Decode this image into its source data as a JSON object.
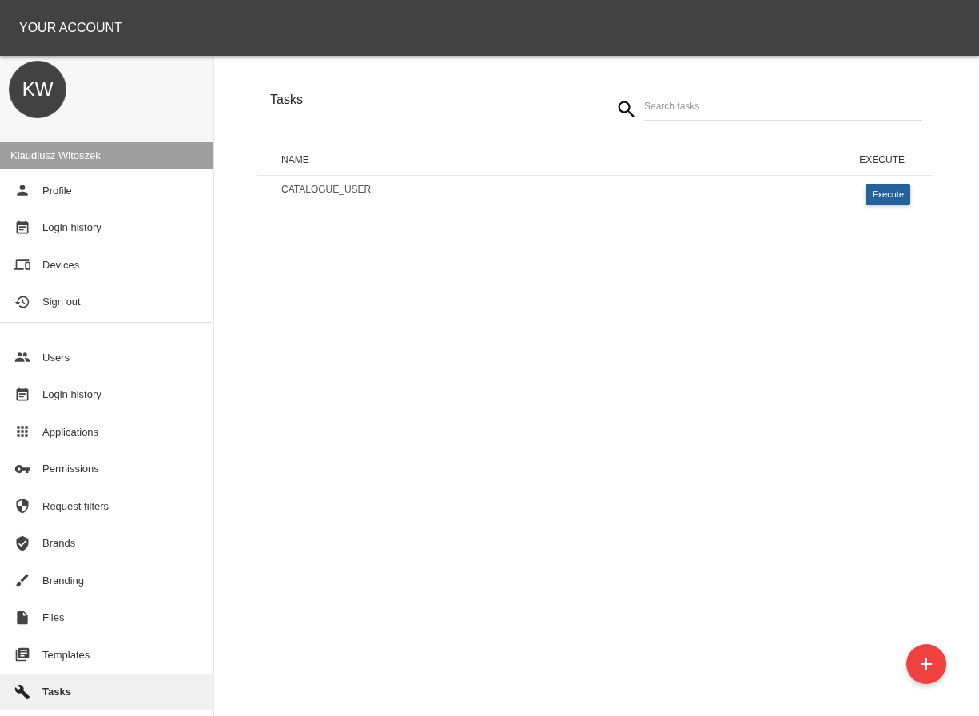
{
  "header": {
    "title": "YOUR ACCOUNT"
  },
  "user": {
    "initials": "KW",
    "name": "Klaudiusz Witoszek"
  },
  "sidebar": {
    "account_items": [
      {
        "label": "Profile",
        "selected": false
      },
      {
        "label": "Login history",
        "selected": false
      },
      {
        "label": "Devices",
        "selected": false
      },
      {
        "label": "Sign out",
        "selected": false
      }
    ],
    "admin_items": [
      {
        "label": "Users",
        "selected": false
      },
      {
        "label": "Login history",
        "selected": false
      },
      {
        "label": "Applications",
        "selected": false
      },
      {
        "label": "Permissions",
        "selected": false
      },
      {
        "label": "Request filters",
        "selected": false
      },
      {
        "label": "Brands",
        "selected": false
      },
      {
        "label": "Branding",
        "selected": false
      },
      {
        "label": "Files",
        "selected": false
      },
      {
        "label": "Templates",
        "selected": false
      },
      {
        "label": "Tasks",
        "selected": true
      }
    ]
  },
  "main": {
    "title": "Tasks",
    "search": {
      "placeholder": "Search tasks"
    },
    "table": {
      "columns": [
        "NAME",
        "EXECUTE"
      ],
      "rows": [
        {
          "name": "CATALOGUE_USER",
          "action": "Execute"
        }
      ]
    }
  }
}
